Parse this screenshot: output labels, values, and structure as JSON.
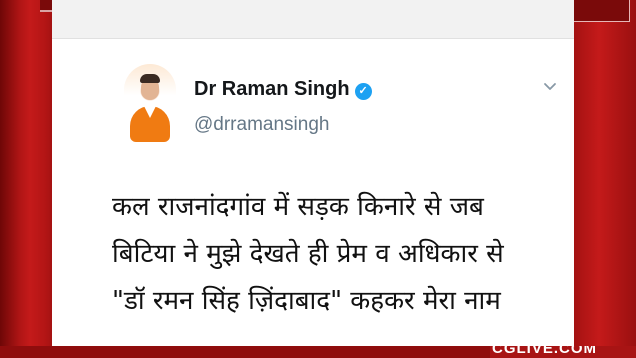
{
  "tweet": {
    "author_name": "Dr Raman Singh",
    "handle": "@drramansingh",
    "text_lines": [
      "कल राजनांदगांव में सड़क किनारे से जब",
      "बिटिया ने मुझे देखते ही प्रेम व अधिकार से",
      "\"डॉ रमन सिंह ज़िंदाबाद\" कहकर मेरा नाम",
      "........ ... ....... .. .... .. .... ....."
    ],
    "more_options_icon": "chevron-down-icon",
    "verified_icon": "verified-badge-icon",
    "colors": {
      "verified": "#1da1f2",
      "handle": "#657786",
      "frame": "#b31515"
    }
  },
  "broadcast": {
    "logo_text": "CGLIVE.COM"
  }
}
